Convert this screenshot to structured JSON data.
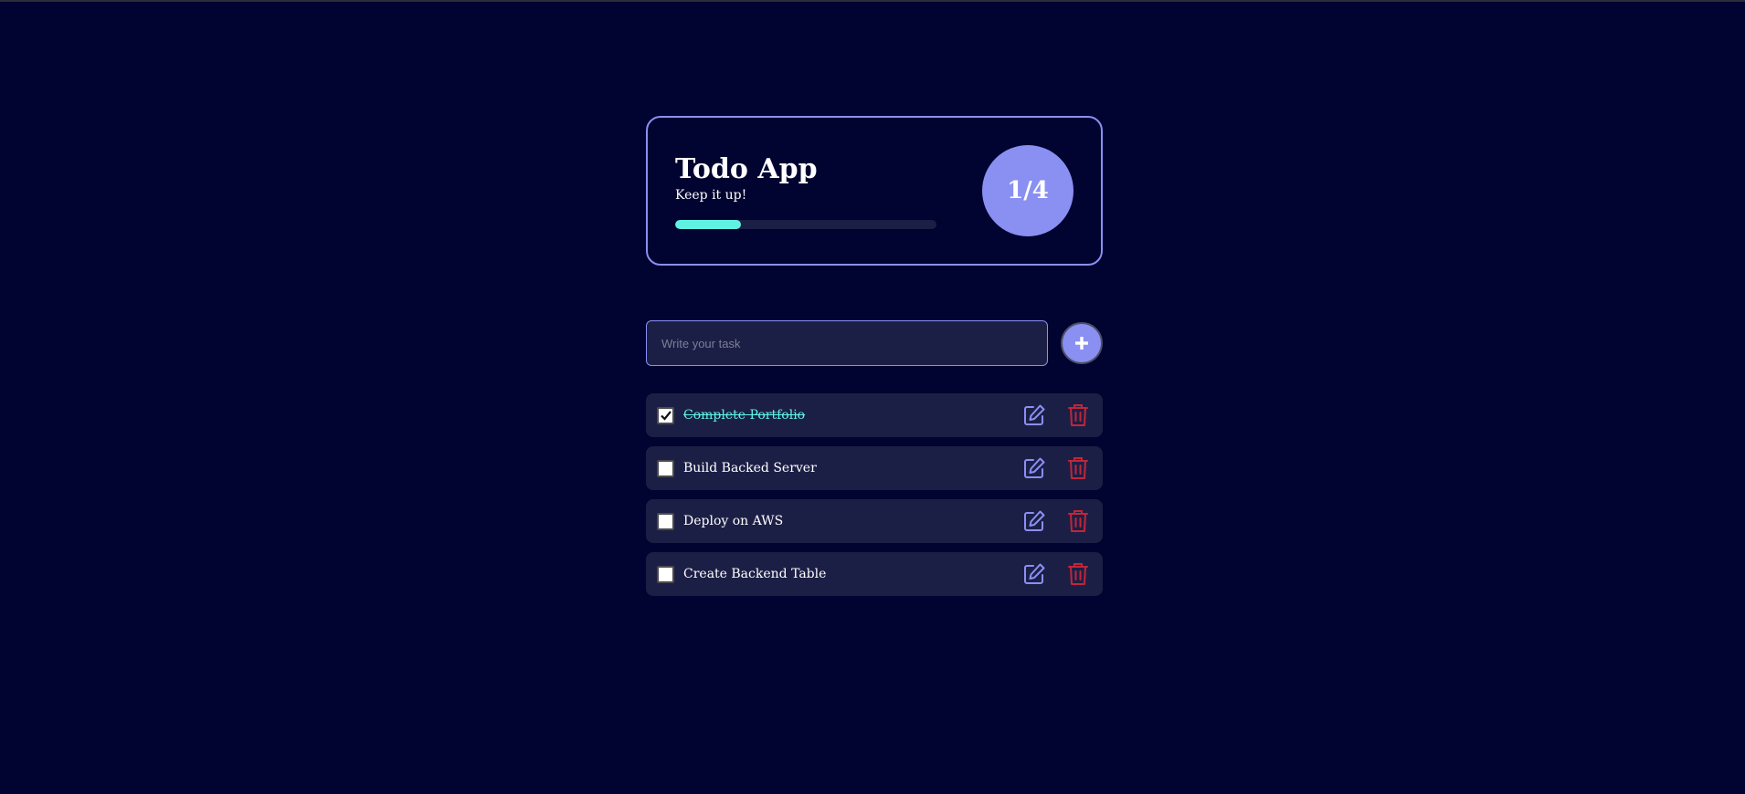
{
  "header": {
    "title": "Todo App",
    "subtitle": "Keep it up!",
    "progress": 0.25,
    "counter": "1/4"
  },
  "input": {
    "placeholder": "Write your task",
    "value": ""
  },
  "todos": [
    {
      "text": "Complete Portfolio",
      "completed": true
    },
    {
      "text": "Build Backed Server",
      "completed": false
    },
    {
      "text": "Deploy on AWS",
      "completed": false
    },
    {
      "text": "Create Backend Table",
      "completed": false
    }
  ],
  "icons": {
    "add": "plus-icon",
    "edit": "edit-icon",
    "delete": "trash-icon",
    "check": "checkmark-icon"
  },
  "colors": {
    "background": "#010430",
    "accent": "#8a8ff2",
    "progress": "#5ff2e3",
    "card": "#1c1f45",
    "delete": "#c0263a",
    "edit": "#8a8ff2"
  }
}
